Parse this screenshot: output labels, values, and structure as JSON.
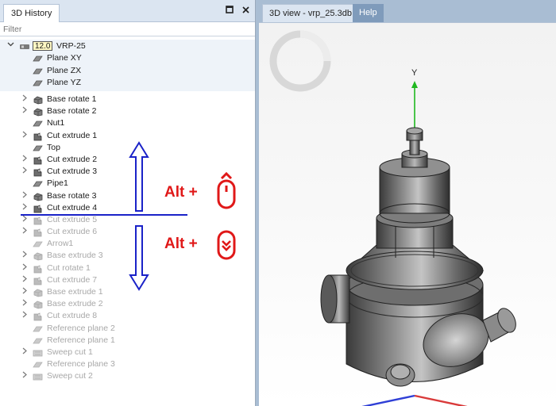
{
  "left_panel": {
    "tab_label": "3D History",
    "filter_placeholder": "Filter",
    "root": {
      "version": "12.0",
      "name": "VRP-25",
      "children": [
        "Plane XY",
        "Plane ZX",
        "Plane YZ"
      ]
    },
    "items": [
      {
        "label": "Base rotate 1",
        "icon": "base-rotate-icon",
        "expandable": true,
        "rolled_back": false
      },
      {
        "label": "Base rotate 2",
        "icon": "base-rotate-icon",
        "expandable": true,
        "rolled_back": false
      },
      {
        "label": "Nut1",
        "icon": "plane-icon",
        "expandable": false,
        "rolled_back": false
      },
      {
        "label": "Cut extrude 1",
        "icon": "cut-extrude-icon",
        "expandable": true,
        "rolled_back": false
      },
      {
        "label": "Top",
        "icon": "plane-icon",
        "expandable": false,
        "rolled_back": false
      },
      {
        "label": "Cut extrude 2",
        "icon": "cut-extrude-icon",
        "expandable": true,
        "rolled_back": false
      },
      {
        "label": "Cut extrude 3",
        "icon": "cut-extrude-icon",
        "expandable": true,
        "rolled_back": false
      },
      {
        "label": "Pipe1",
        "icon": "plane-icon",
        "expandable": false,
        "rolled_back": false
      },
      {
        "label": "Base rotate 3",
        "icon": "base-rotate-icon",
        "expandable": true,
        "rolled_back": false
      },
      {
        "label": "Cut extrude 4",
        "icon": "cut-extrude-icon",
        "expandable": true,
        "rolled_back": false
      },
      {
        "label": "Cut extrude 5",
        "icon": "cut-extrude-icon",
        "expandable": true,
        "rolled_back": true
      },
      {
        "label": "Cut extrude 6",
        "icon": "cut-extrude-icon",
        "expandable": true,
        "rolled_back": true
      },
      {
        "label": "Arrow1",
        "icon": "plane-icon",
        "expandable": false,
        "rolled_back": true
      },
      {
        "label": "Base extrude 3",
        "icon": "base-rotate-icon",
        "expandable": true,
        "rolled_back": true
      },
      {
        "label": "Cut rotate 1",
        "icon": "cut-extrude-icon",
        "expandable": true,
        "rolled_back": true
      },
      {
        "label": "Cut extrude 7",
        "icon": "cut-extrude-icon",
        "expandable": true,
        "rolled_back": true
      },
      {
        "label": "Base extrude 1",
        "icon": "base-rotate-icon",
        "expandable": true,
        "rolled_back": true
      },
      {
        "label": "Base extrude 2",
        "icon": "base-rotate-icon",
        "expandable": true,
        "rolled_back": true
      },
      {
        "label": "Cut extrude 8",
        "icon": "cut-extrude-icon",
        "expandable": true,
        "rolled_back": true
      },
      {
        "label": "Reference plane 2",
        "icon": "plane-icon",
        "expandable": false,
        "rolled_back": true
      },
      {
        "label": "Reference plane 1",
        "icon": "plane-icon",
        "expandable": false,
        "rolled_back": true
      },
      {
        "label": "Sweep cut 1",
        "icon": "sweep-cut-icon",
        "expandable": true,
        "rolled_back": true
      },
      {
        "label": "Reference plane 3",
        "icon": "plane-icon",
        "expandable": false,
        "rolled_back": true
      },
      {
        "label": "Sweep cut 2",
        "icon": "sweep-cut-icon",
        "expandable": true,
        "rolled_back": true
      }
    ]
  },
  "annotations": {
    "up_label": "Alt +",
    "down_label": "Alt +",
    "line_color": "#1a22c8",
    "text_color": "#e01818"
  },
  "right_panel": {
    "tabs": [
      {
        "label": "3D view - vrp_25.3db",
        "active": true
      },
      {
        "label": "Help",
        "active": false
      }
    ],
    "axis_label": "Y"
  }
}
